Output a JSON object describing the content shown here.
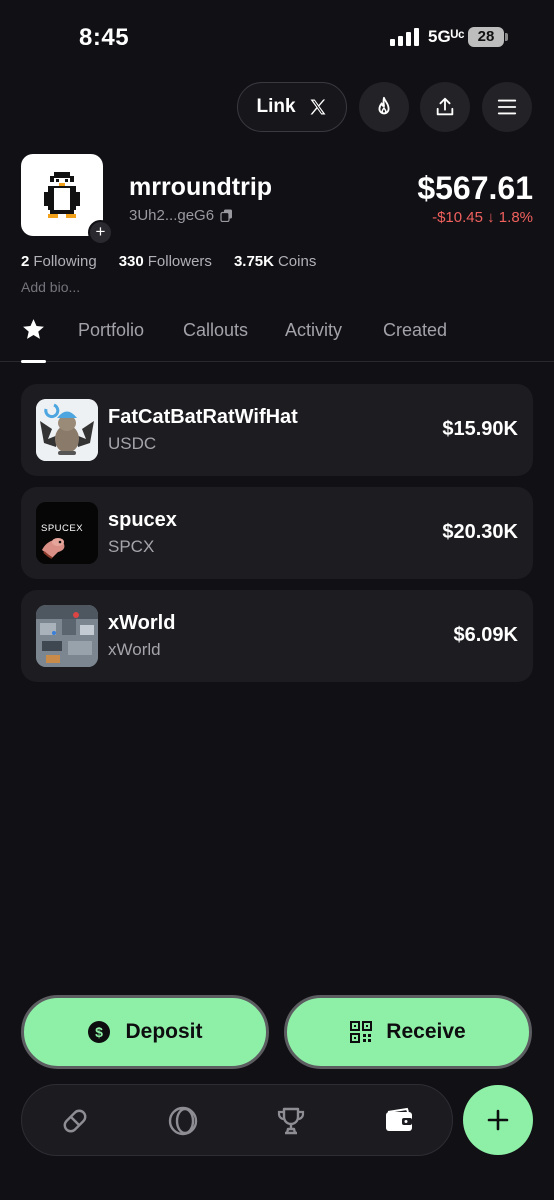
{
  "status_bar": {
    "time": "8:45",
    "network": "5Gᵁᶜ",
    "battery": "28"
  },
  "header": {
    "link_label": "Link"
  },
  "profile": {
    "username": "mrroundtrip",
    "address": "3Uh2...geG6",
    "balance": "$567.61",
    "change": "-$10.45 ↓ 1.8%",
    "stats": [
      {
        "value": "2",
        "label": "Following"
      },
      {
        "value": "330",
        "label": "Followers"
      },
      {
        "value": "3.75K",
        "label": "Coins"
      }
    ],
    "bio_placeholder": "Add bio..."
  },
  "tabs": [
    "Portfolio",
    "Callouts",
    "Activity",
    "Created"
  ],
  "holdings": [
    {
      "name": "FatCatBatRatWifHat",
      "symbol": "USDC",
      "value": "$15.90K"
    },
    {
      "name": "spucex",
      "symbol": "SPCX",
      "value": "$20.30K",
      "image_text": "SPUCEX"
    },
    {
      "name": "xWorld",
      "symbol": "xWorld",
      "value": "$6.09K"
    }
  ],
  "actions": {
    "deposit": "Deposit",
    "receive": "Receive"
  },
  "colors": {
    "accent": "#8ef0a7",
    "negative": "#f0605d",
    "background": "#111015",
    "card": "#1d1c21"
  }
}
